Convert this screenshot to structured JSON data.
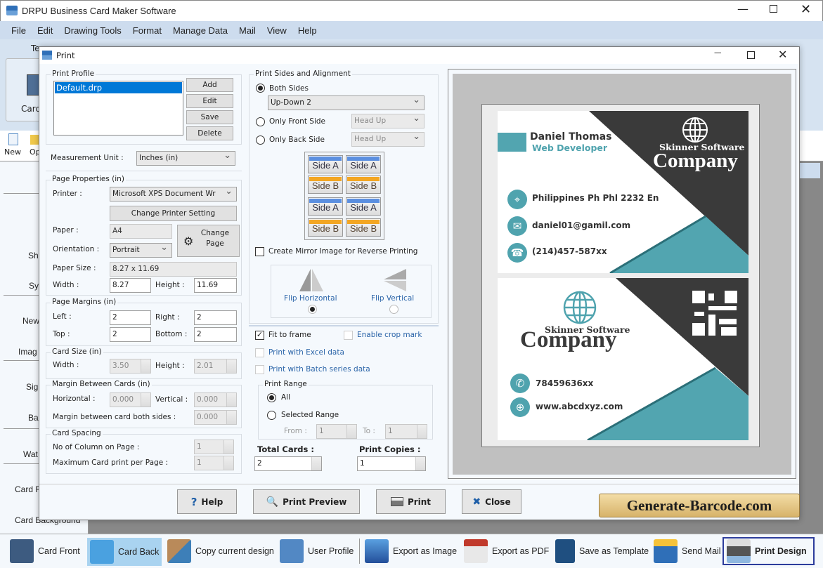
{
  "app": {
    "title": "DRPU Business Card Maker Software",
    "menu": [
      "File",
      "Edit",
      "Drawing Tools",
      "Format",
      "Manage Data",
      "Mail",
      "View",
      "Help"
    ],
    "ribbon_fragments": {
      "tab": "Te",
      "card": "Card",
      "new": "New",
      "open": "Op"
    },
    "sidebar_fragments": [
      "Sh",
      "Sy",
      "New",
      "Imag",
      "Sig",
      "Ba",
      "Wat",
      "Card F",
      "Card Background"
    ],
    "bottom_toolbar": [
      {
        "label": "Card Front",
        "icon": "card-front-icon"
      },
      {
        "label": "Card Back",
        "icon": "card-back-icon",
        "active": true
      },
      {
        "label": "Copy current design",
        "icon": "copy-design-icon"
      },
      {
        "label": "User Profile",
        "icon": "user-profile-icon"
      },
      {
        "label": "Export as Image",
        "icon": "export-image-icon"
      },
      {
        "label": "Export as PDF",
        "icon": "pdf-icon"
      },
      {
        "label": "Save as Template",
        "icon": "save-template-icon"
      },
      {
        "label": "Send Mail",
        "icon": "send-mail-icon"
      },
      {
        "label": "Print Design",
        "icon": "printer-icon",
        "selected": true
      }
    ]
  },
  "dialog": {
    "title": "Print",
    "print_profile": {
      "label": "Print Profile",
      "items": [
        "Default.drp"
      ],
      "selected": "Default.drp",
      "buttons": [
        "Add",
        "Edit",
        "Save",
        "Delete"
      ]
    },
    "measurement": {
      "label": "Measurement Unit :",
      "value": "Inches (in)"
    },
    "page_properties": {
      "label": "Page Properties (in)",
      "printer_label": "Printer :",
      "printer": "Microsoft XPS Document Wr",
      "change_printer": "Change Printer Setting",
      "paper_label": "Paper :",
      "paper": "A4",
      "change_page": "Change Page",
      "orientation_label": "Orientation :",
      "orientation": "Portrait",
      "paper_size_label": "Paper Size :",
      "paper_size": "8.27 x 11.69",
      "width_label": "Width :",
      "width": "8.27",
      "height_label": "Height :",
      "height": "11.69"
    },
    "page_margins": {
      "label": "Page Margins (in)",
      "left_label": "Left :",
      "left": "2",
      "right_label": "Right :",
      "right": "2",
      "top_label": "Top :",
      "top": "2",
      "bottom_label": "Bottom :",
      "bottom": "2"
    },
    "card_size": {
      "label": "Card Size (in)",
      "width_label": "Width :",
      "width": "3.50",
      "height_label": "Height :",
      "height": "2.01"
    },
    "margin_between": {
      "label": "Margin Between Cards (in)",
      "horizontal_label": "Horizontal :",
      "horizontal": "0.000",
      "vertical_label": "Vertical :",
      "vertical": "0.000",
      "both_label": "Margin between card both sides :",
      "both": "0.000"
    },
    "card_spacing": {
      "label": "Card Spacing",
      "columns_label": "No of Column on Page :",
      "columns": "1",
      "max_label": "Maximum Card print per Page :",
      "max": "1"
    },
    "sides": {
      "label": "Print Sides and Alignment",
      "both": "Both Sides",
      "both_value": "Up-Down 2",
      "front": "Only Front Side",
      "front_value": "Head Up",
      "back": "Only Back Side",
      "back_value": "Head Up",
      "selected": "Both Sides",
      "layout": [
        "Side A",
        "Side A",
        "Side B",
        "Side B",
        "Side A",
        "Side A",
        "Side B",
        "Side B"
      ]
    },
    "mirror": {
      "label": "Create Mirror Image for Reverse Printing",
      "checked": false,
      "flip_h": "Flip Horizontal",
      "flip_v": "Flip Vertical",
      "selected": "Flip Horizontal"
    },
    "options": {
      "fit": "Fit to frame",
      "fit_checked": true,
      "crop": "Enable crop mark",
      "excel": "Print with Excel data",
      "batch": "Print with Batch series data"
    },
    "range": {
      "label": "Print Range",
      "all": "All",
      "selected_range": "Selected Range",
      "from_label": "From :",
      "from": "1",
      "to_label": "To :",
      "to": "1",
      "selected": "All"
    },
    "total_cards_label": "Total Cards :",
    "total_cards": "2",
    "copies_label": "Print Copies :",
    "copies": "1",
    "buttons": {
      "help": "Help",
      "preview": "Print Preview",
      "print": "Print",
      "close": "Close"
    }
  },
  "preview": {
    "front": {
      "name": "Daniel Thomas",
      "role": "Web Developer",
      "company_top": "Skinner Software",
      "company": "Company",
      "address": "Philippines Ph Phl 2232 En",
      "email": "daniel01@gamil.com",
      "phone": "(214)457-587xx"
    },
    "back": {
      "company_top": "Skinner Software",
      "company": "Company",
      "phone": "78459636xx",
      "web": "www.abcdxyz.com"
    }
  },
  "watermark": "Generate-Barcode.com",
  "colors": {
    "teal": "#52a5b0",
    "dark": "#3a3a3a",
    "accent_blue": "#0078d7"
  }
}
